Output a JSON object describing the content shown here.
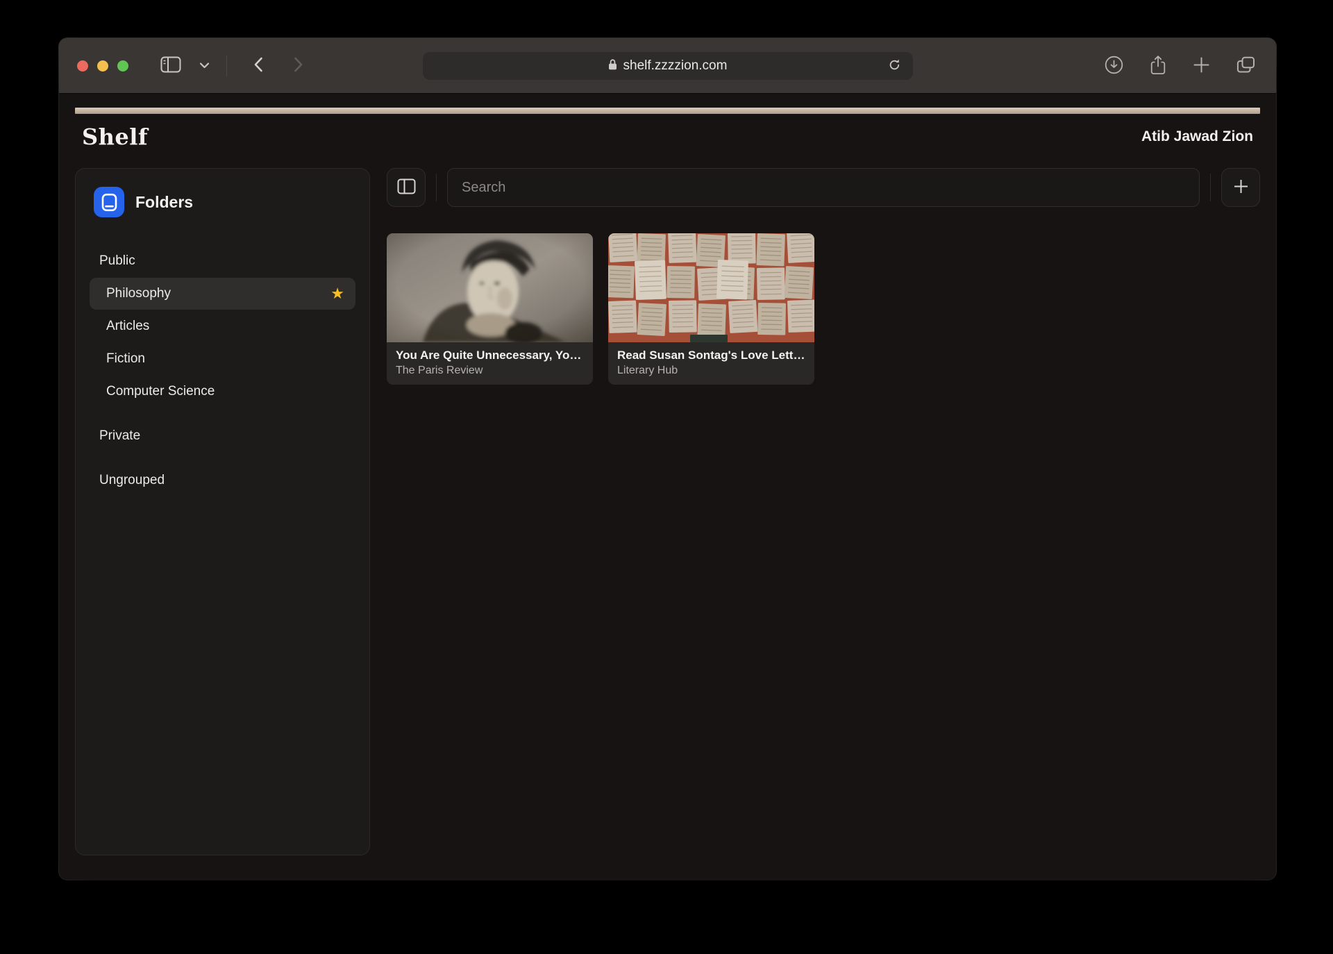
{
  "browser": {
    "url": "shelf.zzzzion.com",
    "window_controls": [
      "close",
      "minimize",
      "zoom"
    ]
  },
  "site": {
    "logo": "Shelf",
    "user_name": "Atib Jawad Zion"
  },
  "folders_panel": {
    "title": "Folders",
    "items": [
      {
        "label": "Public",
        "level": 0,
        "selected": false,
        "starred": false
      },
      {
        "label": "Philosophy",
        "level": 1,
        "selected": true,
        "starred": true
      },
      {
        "label": "Articles",
        "level": 1,
        "selected": false,
        "starred": false
      },
      {
        "label": "Fiction",
        "level": 1,
        "selected": false,
        "starred": false
      },
      {
        "label": "Computer Science",
        "level": 1,
        "selected": false,
        "starred": false
      },
      {
        "label": "Private",
        "level": 0,
        "selected": false,
        "starred": false
      },
      {
        "label": "Ungrouped",
        "level": 0,
        "selected": false,
        "starred": false
      }
    ]
  },
  "search": {
    "placeholder": "Search"
  },
  "cards": [
    {
      "title": "You Are Quite Unnecessary, You...",
      "source": "The Paris Review",
      "image_alt": "sepia black-and-white portrait of a man wearing a cap"
    },
    {
      "title": "Read Susan Sontag's Love Lette...",
      "source": "Literary Hub",
      "image_alt": "wall collage of open book pages on a terracotta background"
    }
  ],
  "icons": {
    "star": "★"
  },
  "colors": {
    "accent_bar": "#c9b6a5",
    "folder_icon_bg": "#2563eb",
    "star": "#fbbf24",
    "page_background": "#161312",
    "toolbar_background": "#393633"
  }
}
